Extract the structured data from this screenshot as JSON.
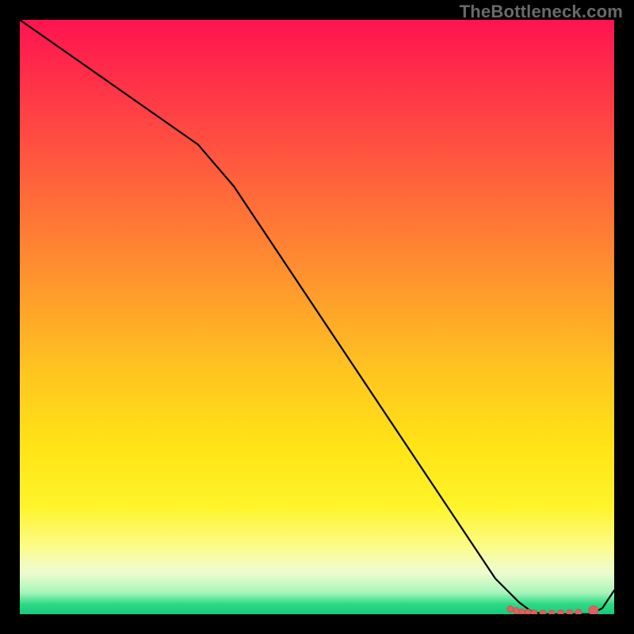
{
  "watermark": "TheBottleneck.com",
  "colors": {
    "frame_bg": "#000000",
    "curve_stroke": "#000000",
    "marker_fill": "#e06060",
    "marker_stroke": "#c94f4f"
  },
  "chart_data": {
    "type": "line",
    "title": "",
    "xlabel": "",
    "ylabel": "",
    "xlim": [
      0,
      100
    ],
    "ylim": [
      0,
      100
    ],
    "grid": false,
    "series": [
      {
        "name": "curve",
        "x": [
          0,
          10,
          20,
          30,
          36,
          44,
          52,
          60,
          68,
          76,
          80,
          84,
          86,
          88,
          90,
          92,
          94,
          96,
          98,
          100
        ],
        "y": [
          100,
          93,
          86,
          79,
          72,
          60,
          48,
          36,
          24,
          12,
          6,
          2,
          0.5,
          0,
          0,
          0,
          0,
          0,
          1,
          4
        ]
      }
    ],
    "markers": [
      {
        "x": 82.5,
        "y": 0.9,
        "r": 2
      },
      {
        "x": 83.5,
        "y": 0.6,
        "r": 2
      },
      {
        "x": 84.5,
        "y": 0.4,
        "r": 2
      },
      {
        "x": 85.5,
        "y": 0.3,
        "r": 2
      },
      {
        "x": 86.5,
        "y": 0.2,
        "r": 2
      },
      {
        "x": 88.0,
        "y": 0.15,
        "r": 2
      },
      {
        "x": 89.5,
        "y": 0.15,
        "r": 2
      },
      {
        "x": 91.0,
        "y": 0.2,
        "r": 2
      },
      {
        "x": 92.5,
        "y": 0.25,
        "r": 2
      },
      {
        "x": 94.0,
        "y": 0.3,
        "r": 2
      },
      {
        "x": 96.5,
        "y": 0.6,
        "r": 3
      }
    ]
  }
}
